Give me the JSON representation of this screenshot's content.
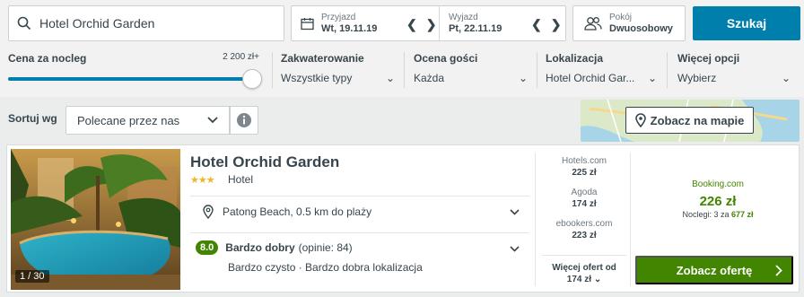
{
  "search": {
    "destination": "Hotel Orchid Garden",
    "button": "Szukaj"
  },
  "dates": {
    "checkin": {
      "label": "Przyjazd",
      "value": "Wt, 19.11.19"
    },
    "checkout": {
      "label": "Wyjazd",
      "value": "Pt, 22.11.19"
    }
  },
  "rooms": {
    "label": "Pokój",
    "value": "Dwuosobowy"
  },
  "filters": {
    "price": {
      "label": "Cena za nocleg",
      "max": "2 200 zł+",
      "level": 1.0
    },
    "accommodation": {
      "label": "Zakwaterowanie",
      "value": "Wszystkie typy"
    },
    "rating": {
      "label": "Ocena gości",
      "value": "Każda"
    },
    "location": {
      "label": "Lokalizacja",
      "value": "Hotel Orchid Gar..."
    },
    "more": {
      "label": "Więcej opcji",
      "value": "Wybierz"
    }
  },
  "sort": {
    "label": "Sortuj wg",
    "value": "Polecane przez nas"
  },
  "map": {
    "button": "Zobacz na mapie"
  },
  "hotel": {
    "name": "Hotel Orchid Garden",
    "stars": 3,
    "stars_text": "★★★",
    "type": "Hotel",
    "photo_counter": "1 / 30",
    "location": "Patong Beach, 0.5 km do plaży",
    "rating_score": "8.0",
    "rating_text": "Bardzo dobry",
    "rating_count": "(opinie: 84)",
    "rating_sub": "Bardzo czysto · Bardzo dobra lokalizacja",
    "offers": [
      {
        "provider": "Hotels.com",
        "price": "225 zł"
      },
      {
        "provider": "Agoda",
        "price": "174 zł"
      },
      {
        "provider": "ebookers.com",
        "price": "223 zł"
      }
    ],
    "more_offers": {
      "line1": "Więcej ofert od",
      "line2": "174 zł"
    },
    "best": {
      "provider": "Booking.com",
      "price": "226 zł",
      "nights_prefix": "Noclegi: 3 za",
      "nights_total": "677 zł"
    },
    "deal_button": "Zobacz ofertę"
  },
  "colors": {
    "brand": "#007fad",
    "deal": "#428500",
    "star": "#f5b41f"
  }
}
